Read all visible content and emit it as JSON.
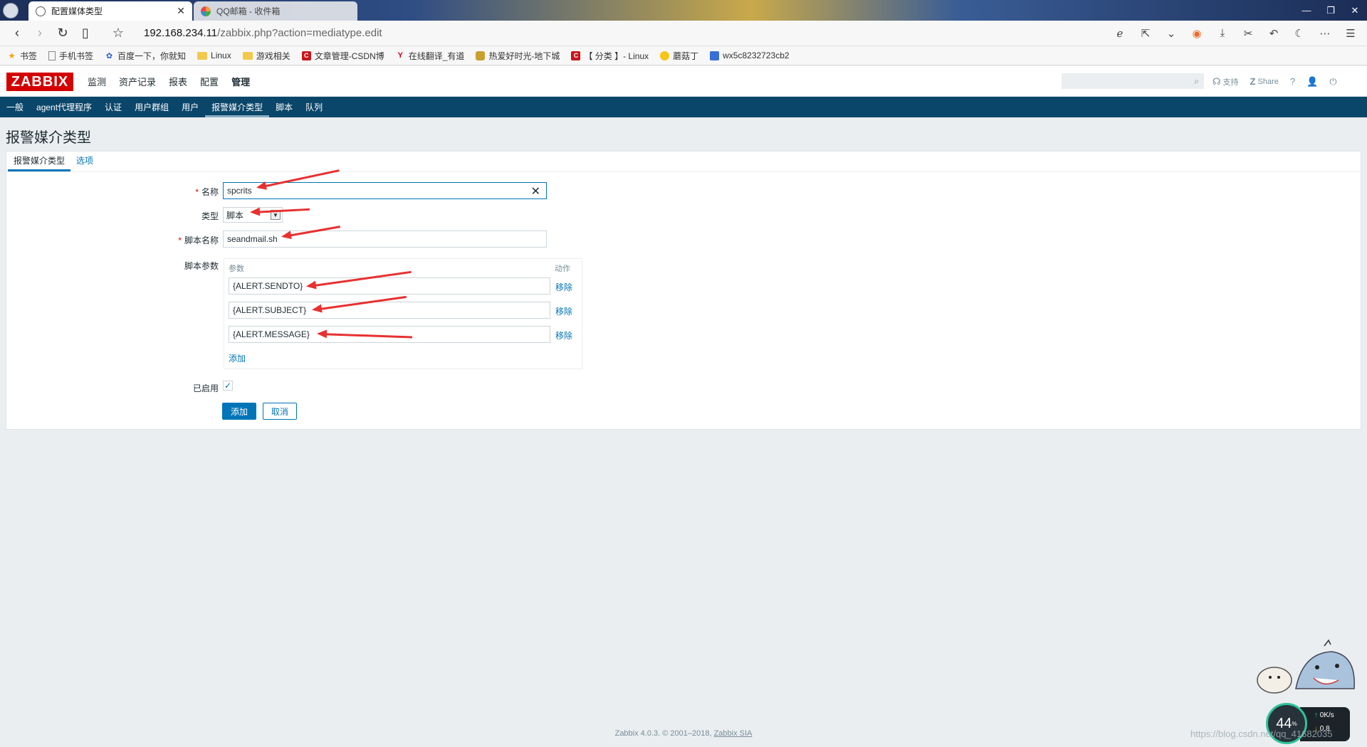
{
  "browser": {
    "tabs": [
      {
        "label": "配置媒体类型",
        "close": "✕"
      },
      {
        "label": "QQ邮箱 - 收件箱"
      }
    ],
    "url_host": "192.168.234.11",
    "url_path": "/zabbix.php?action=mediatype.edit",
    "bookmarks": [
      "书签",
      "手机书签",
      "百度一下，你就知",
      "Linux",
      "游戏相关",
      "文章管理-CSDN博",
      "在线翻译_有道",
      "热爱好时光-地下城",
      "【 分类 】- Linux",
      "蘑菇丁",
      "wx5c8232723cb2"
    ]
  },
  "zabbix": {
    "logo": "ZABBIX",
    "menu": [
      "监测",
      "资产记录",
      "报表",
      "配置",
      "管理"
    ],
    "selected_menu": "管理",
    "support": "支持",
    "share": "Share",
    "help": "?",
    "submenu": [
      "一般",
      "agent代理程序",
      "认证",
      "用户群组",
      "用户",
      "报警媒介类型",
      "脚本",
      "队列"
    ],
    "selected_submenu": "报警媒介类型",
    "page_title": "报警媒介类型",
    "form_tabs": [
      "报警媒介类型",
      "选项"
    ],
    "form": {
      "name_label": "名称",
      "name_value": "spcrits",
      "type_label": "类型",
      "type_value": "脚本",
      "script_label": "脚本名称",
      "script_value": "seandmail.sh",
      "params_label": "脚本参数",
      "params_col": "参数",
      "action_col": "动作",
      "params": [
        "{ALERT.SENDTO}",
        "{ALERT.SUBJECT}",
        "{ALERT.MESSAGE}"
      ],
      "remove": "移除",
      "add_link": "添加",
      "enabled_label": "已启用",
      "enabled": true,
      "add_button": "添加",
      "cancel_button": "取消"
    },
    "footer_text": "Zabbix 4.0.3. © 2001–2018, ",
    "footer_link": "Zabbix SIA"
  },
  "widget": {
    "cpu_percent": "44",
    "percent_sign": "%",
    "net_up": "0K/s",
    "net_down": "0.8"
  },
  "watermark": "https://blog.csdn.net/qq_41682035",
  "accent_color": "#0275b8",
  "nav_color": "#0a466a",
  "logo_color": "#d40000"
}
